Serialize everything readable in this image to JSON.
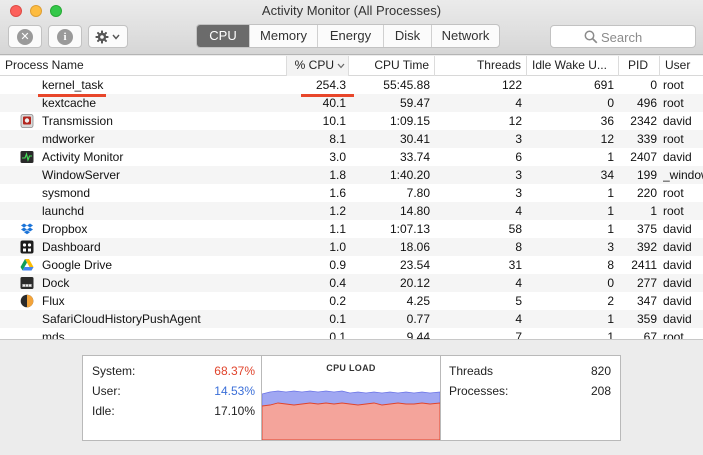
{
  "window": {
    "title": "Activity Monitor (All Processes)"
  },
  "toolbar": {
    "close_icon": "x-circle-icon",
    "info_icon": "info-circle-icon",
    "gear_icon": "gear-icon",
    "tabs": [
      "CPU",
      "Memory",
      "Energy",
      "Disk",
      "Network"
    ],
    "active_tab": "CPU",
    "search_placeholder": "Search"
  },
  "table": {
    "columns": [
      "Process Name",
      "% CPU",
      "CPU Time",
      "Threads",
      "Idle Wake U...",
      "PID",
      "User"
    ],
    "sort_column": "% CPU",
    "rows": [
      {
        "icon": "",
        "name": "kernel_task",
        "cpu": "254.3",
        "time": "55:45.88",
        "threads": "122",
        "idle": "691",
        "pid": "0",
        "user": "root"
      },
      {
        "icon": "",
        "name": "kextcache",
        "cpu": "40.1",
        "time": "59.47",
        "threads": "4",
        "idle": "0",
        "pid": "496",
        "user": "root"
      },
      {
        "icon": "transmission-icon",
        "name": "Transmission",
        "cpu": "10.1",
        "time": "1:09.15",
        "threads": "12",
        "idle": "36",
        "pid": "2342",
        "user": "david"
      },
      {
        "icon": "",
        "name": "mdworker",
        "cpu": "8.1",
        "time": "30.41",
        "threads": "3",
        "idle": "12",
        "pid": "339",
        "user": "root"
      },
      {
        "icon": "activity-monitor-icon",
        "name": "Activity Monitor",
        "cpu": "3.0",
        "time": "33.74",
        "threads": "6",
        "idle": "1",
        "pid": "2407",
        "user": "david"
      },
      {
        "icon": "",
        "name": "WindowServer",
        "cpu": "1.8",
        "time": "1:40.20",
        "threads": "3",
        "idle": "34",
        "pid": "199",
        "user": "_window"
      },
      {
        "icon": "",
        "name": "sysmond",
        "cpu": "1.6",
        "time": "7.80",
        "threads": "3",
        "idle": "1",
        "pid": "220",
        "user": "root"
      },
      {
        "icon": "",
        "name": "launchd",
        "cpu": "1.2",
        "time": "14.80",
        "threads": "4",
        "idle": "1",
        "pid": "1",
        "user": "root"
      },
      {
        "icon": "dropbox-icon",
        "name": "Dropbox",
        "cpu": "1.1",
        "time": "1:07.13",
        "threads": "58",
        "idle": "1",
        "pid": "375",
        "user": "david"
      },
      {
        "icon": "dashboard-icon",
        "name": "Dashboard",
        "cpu": "1.0",
        "time": "18.06",
        "threads": "8",
        "idle": "3",
        "pid": "392",
        "user": "david"
      },
      {
        "icon": "google-drive-icon",
        "name": "Google Drive",
        "cpu": "0.9",
        "time": "23.54",
        "threads": "31",
        "idle": "8",
        "pid": "2411",
        "user": "david"
      },
      {
        "icon": "dock-icon",
        "name": "Dock",
        "cpu": "0.4",
        "time": "20.12",
        "threads": "4",
        "idle": "0",
        "pid": "277",
        "user": "david"
      },
      {
        "icon": "flux-icon",
        "name": "Flux",
        "cpu": "0.2",
        "time": "4.25",
        "threads": "5",
        "idle": "2",
        "pid": "347",
        "user": "david"
      },
      {
        "icon": "",
        "name": "SafariCloudHistoryPushAgent",
        "cpu": "0.1",
        "time": "0.77",
        "threads": "4",
        "idle": "1",
        "pid": "359",
        "user": "david"
      },
      {
        "icon": "",
        "name": "mds",
        "cpu": "0.1",
        "time": "9.44",
        "threads": "7",
        "idle": "1",
        "pid": "67",
        "user": "root"
      }
    ]
  },
  "stats": {
    "system_label": "System:",
    "system_value": "68.37%",
    "user_label": "User:",
    "user_value": "14.53%",
    "idle_label": "Idle:",
    "idle_value": "17.10%",
    "chart_title": "CPU LOAD",
    "threads_label": "Threads",
    "threads_value": "820",
    "processes_label": "Processes:",
    "processes_value": "208"
  },
  "colors": {
    "system": "#e0442c",
    "user": "#3b6fd8",
    "system_fill": "#f4a49b",
    "user_fill": "#a0a7f2",
    "active_tab": "#6b6b6b",
    "annotation": "#e8462a"
  }
}
